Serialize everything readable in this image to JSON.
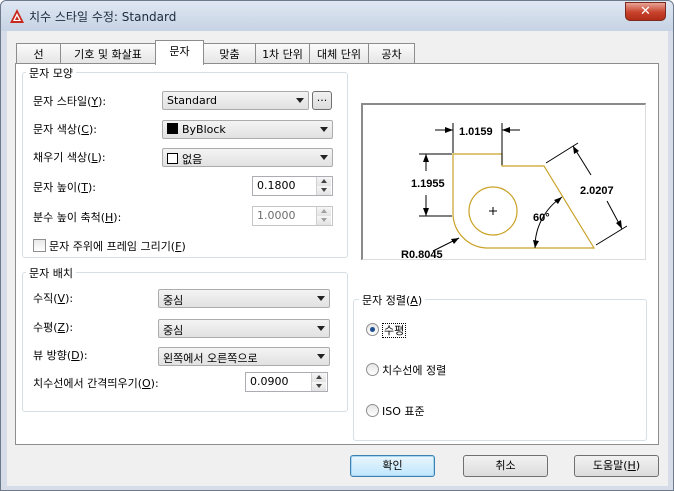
{
  "window": {
    "title": "치수 스타일 수정: Standard",
    "close_glyph": "✕"
  },
  "tabs": [
    {
      "label": "선"
    },
    {
      "label": "기호 및 화살표"
    },
    {
      "label": "문자"
    },
    {
      "label": "맞춤"
    },
    {
      "label": "1차 단위"
    },
    {
      "label": "대체 단위"
    },
    {
      "label": "공차"
    }
  ],
  "active_tab": "문자",
  "text_appearance": {
    "group_label": "문자 모양",
    "style": {
      "label": "문자 스타일(",
      "key": "Y",
      "suffix": "):",
      "value": "Standard",
      "browse_label": "..."
    },
    "color": {
      "label": "문자 색상(",
      "key": "C",
      "suffix": "):",
      "value": "ByBlock",
      "swatch": "#000000"
    },
    "fill": {
      "label": "채우기 색상(",
      "key": "L",
      "suffix": "):",
      "value": "없음",
      "swatch": "#ffffff"
    },
    "height": {
      "label": "문자 높이(",
      "key": "T",
      "suffix": "):",
      "value": "0.1800"
    },
    "fraction": {
      "label": "분수 높이 축척(",
      "key": "H",
      "suffix": "):",
      "value": "1.0000"
    },
    "frame": {
      "label": "문자 주위에 프레임 그리기(",
      "key": "F",
      "suffix": ")",
      "checked": false
    }
  },
  "text_placement": {
    "group_label": "문자 배치",
    "vertical": {
      "label": "수직(",
      "key": "V",
      "suffix": "):",
      "value": "중심"
    },
    "horizontal": {
      "label": "수평(",
      "key": "Z",
      "suffix": "):",
      "value": "중심"
    },
    "view_direction": {
      "label": "뷰 방향(",
      "key": "D",
      "suffix": "):",
      "value": "왼쪽에서 오른쪽으로"
    },
    "offset": {
      "label": "치수선에서 간격띄우기(",
      "key": "O",
      "suffix": "):",
      "value": "0.0900"
    }
  },
  "text_alignment": {
    "group_label": "문자 정렬(",
    "group_key": "A",
    "group_suffix": ")",
    "options": [
      {
        "label": "수평",
        "checked": true
      },
      {
        "label": "치수선에 정렬",
        "checked": false
      },
      {
        "label": "ISO 표준",
        "checked": false
      }
    ]
  },
  "preview": {
    "dim_top": "1.0159",
    "dim_left": "1.1955",
    "dim_right": "2.0207",
    "dim_angle": "60°",
    "dim_radius": "R0.8045",
    "center_mark": "+"
  },
  "buttons": {
    "ok": "확인",
    "cancel": "취소",
    "help": {
      "label": "도움말(",
      "key": "H",
      "suffix": ")"
    }
  },
  "colors": {
    "accent": "#3c7fb1",
    "shape": "#c9a227",
    "close": "#c7412b"
  }
}
